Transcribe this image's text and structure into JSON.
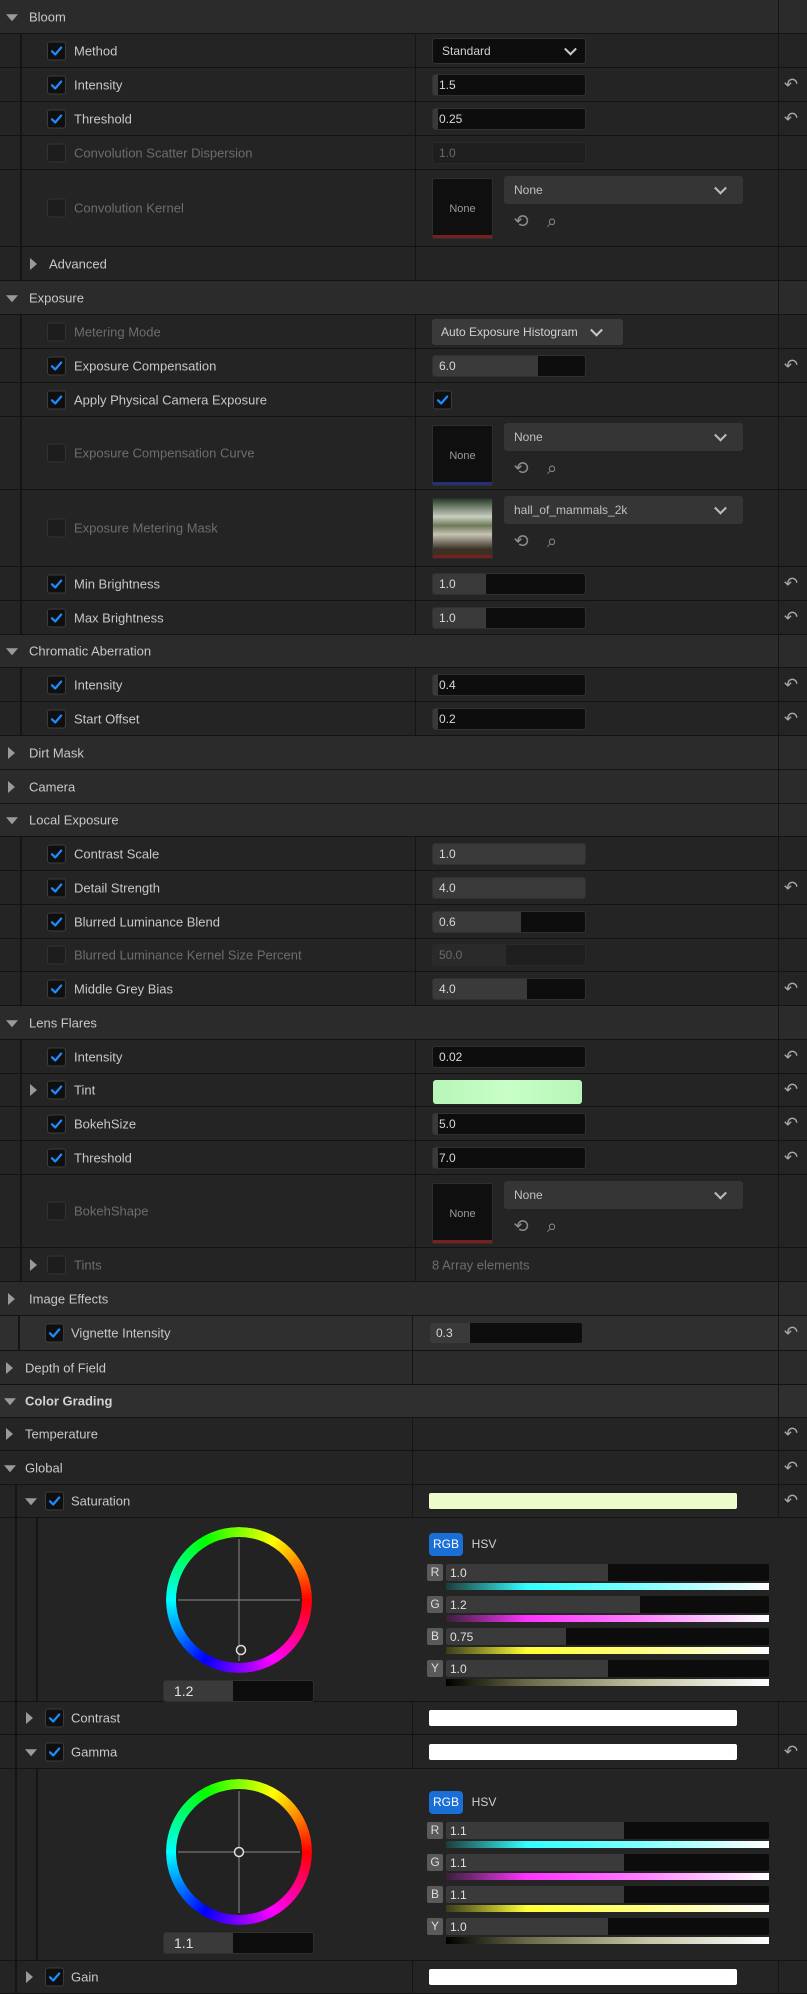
{
  "reset_glyph": "↶",
  "icons": {
    "reset": "reset-arrow-icon",
    "use": "use-selected-asset-icon",
    "browse": "browse-asset-icon",
    "check": "check-icon"
  },
  "colors": {
    "accent": "#0070e0",
    "check": "#1e8cff"
  },
  "bloom": {
    "header": "Bloom",
    "method": {
      "label": "Method",
      "value": "Standard"
    },
    "intensity": {
      "label": "Intensity",
      "value": "1.5",
      "fill": 0.03
    },
    "threshold": {
      "label": "Threshold",
      "value": "0.25",
      "fill": 0.03
    },
    "scatter": {
      "label": "Convolution Scatter Dispersion",
      "value": "1.0"
    },
    "kernel": {
      "label": "Convolution Kernel",
      "thumb": "None",
      "asset": "None"
    },
    "advanced": "Advanced"
  },
  "exposure": {
    "header": "Exposure",
    "metering": {
      "label": "Metering Mode",
      "value": "Auto Exposure Histogram"
    },
    "compensation": {
      "label": "Exposure Compensation",
      "value": "6.0",
      "fill": 0.69
    },
    "physical": {
      "label": "Apply Physical Camera Exposure"
    },
    "curve": {
      "label": "Exposure Compensation Curve",
      "thumb": "None",
      "asset": "None"
    },
    "mask": {
      "label": "Exposure Metering Mask",
      "asset": "hall_of_mammals_2k"
    },
    "min": {
      "label": "Min Brightness",
      "value": "1.0",
      "fill": 0.35
    },
    "max": {
      "label": "Max Brightness",
      "value": "1.0",
      "fill": 0.35
    }
  },
  "chromatic": {
    "header": "Chromatic Aberration",
    "intensity": {
      "label": "Intensity",
      "value": "0.4",
      "fill": 0.03
    },
    "offset": {
      "label": "Start Offset",
      "value": "0.2",
      "fill": 0.03
    }
  },
  "dirt_mask": "Dirt Mask",
  "camera": "Camera",
  "local_exposure": {
    "header": "Local Exposure",
    "contrast": {
      "label": "Contrast Scale",
      "value": "1.0",
      "fill": 1.0
    },
    "detail": {
      "label": "Detail Strength",
      "value": "4.0",
      "fill": 1.0
    },
    "blurred": {
      "label": "Blurred Luminance Blend",
      "value": "0.6",
      "fill": 0.58
    },
    "kernel": {
      "label": "Blurred Luminance Kernel Size Percent",
      "value": "50.0",
      "fill": 0.48
    },
    "grey": {
      "label": "Middle Grey Bias",
      "value": "4.0",
      "fill": 0.62
    }
  },
  "lens_flares": {
    "header": "Lens Flares",
    "intensity": {
      "label": "Intensity",
      "value": "0.02",
      "fill": 0.0
    },
    "tint": {
      "label": "Tint",
      "color": "#c8ffc8"
    },
    "bokeh_size": {
      "label": "BokehSize",
      "value": "5.0",
      "fill": 0.03
    },
    "threshold": {
      "label": "Threshold",
      "value": "7.0",
      "fill": 0.03
    },
    "bokeh_shape": {
      "label": "BokehShape",
      "thumb": "None",
      "asset": "None"
    },
    "tints": {
      "label": "Tints",
      "value": "8 Array elements"
    }
  },
  "image_effects": {
    "header": "Image Effects",
    "vignette": {
      "label": "Vignette Intensity",
      "value": "0.3",
      "fill": 0.26
    }
  },
  "depth_of_field": "Depth of Field",
  "color_grading": {
    "header": "Color Grading",
    "temperature": "Temperature",
    "global": "Global",
    "saturation": {
      "label": "Saturation",
      "bar_color": "#eefccc",
      "wheel_value": "1.2",
      "mode_rgb": "RGB",
      "mode_hsv": "HSV",
      "sliders": [
        {
          "tag": "R",
          "value": "1.0",
          "fill": 0.5
        },
        {
          "tag": "G",
          "value": "1.2",
          "fill": 0.6
        },
        {
          "tag": "B",
          "value": "0.75",
          "fill": 0.37
        },
        {
          "tag": "Y",
          "value": "1.0",
          "fill": 0.5
        }
      ]
    },
    "contrast": {
      "label": "Contrast"
    },
    "gamma": {
      "label": "Gamma",
      "wheel_value": "1.1",
      "mode_rgb": "RGB",
      "mode_hsv": "HSV",
      "sliders": [
        {
          "tag": "R",
          "value": "1.1",
          "fill": 0.55
        },
        {
          "tag": "G",
          "value": "1.1",
          "fill": 0.55
        },
        {
          "tag": "B",
          "value": "1.1",
          "fill": 0.55
        },
        {
          "tag": "Y",
          "value": "1.0",
          "fill": 0.5
        }
      ]
    },
    "gain": {
      "label": "Gain"
    }
  }
}
